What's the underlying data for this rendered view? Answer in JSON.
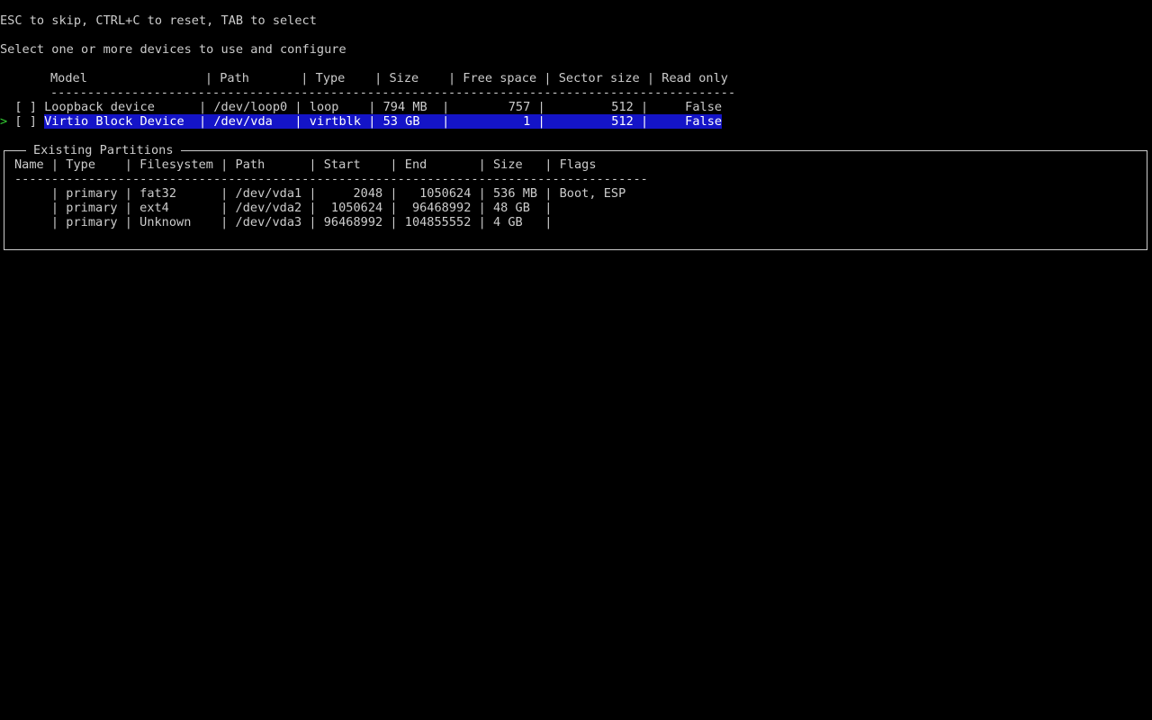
{
  "hint": "ESC to skip, CTRL+C to reset, TAB to select",
  "prompt": "Select one or more devices to use and configure",
  "devices": {
    "header": "Model                | Path       | Type    | Size    | Free space | Sector size | Read only",
    "separator": "---------------------------------------------------------------------------------------------",
    "rows": [
      {
        "cursor": " ",
        "checkbox": "[ ]",
        "text": "Loopback device      | /dev/loop0 | loop    | 794 MB  |        757 |         512 |     False"
      },
      {
        "cursor": ">",
        "checkbox": "[ ]",
        "text": "Virtio Block Device  | /dev/vda   | virtblk | 53 GB   |          1 |         512 |     False"
      }
    ]
  },
  "partitions": {
    "title": "Existing Partitions",
    "header": "Name | Type    | Filesystem | Path      | Start    | End       | Size   | Flags",
    "separator": "--------------------------------------------------------------------------------------",
    "rows": [
      "     | primary | fat32      | /dev/vda1 |     2048 |   1050624 | 536 MB | Boot, ESP",
      "     | primary | ext4       | /dev/vda2 |  1050624 |  96468992 | 48 GB  |",
      "     | primary | Unknown    | /dev/vda3 | 96468992 | 104855552 | 4 GB   |"
    ]
  },
  "colors": {
    "background": "#000000",
    "foreground": "#cccccc",
    "selection": "#1414c8",
    "cursor": "#33cc33"
  }
}
